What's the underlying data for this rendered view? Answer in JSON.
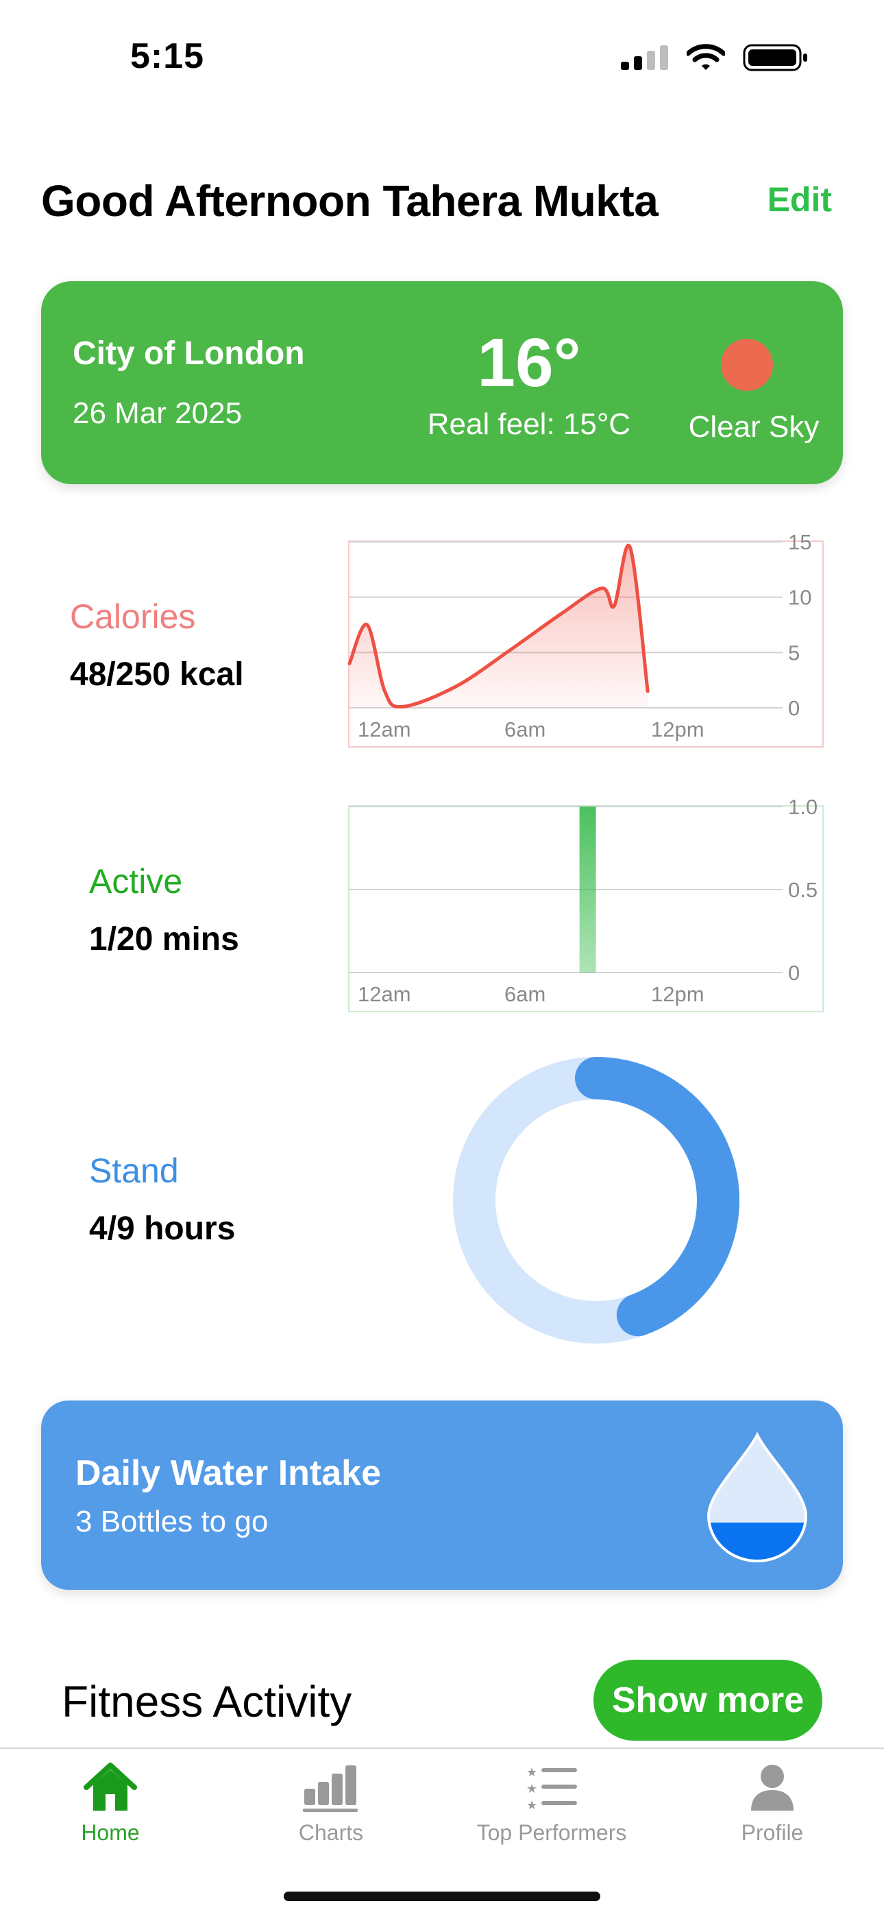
{
  "status_bar": {
    "time": "5:15",
    "icons": [
      "cellular-signal-icon",
      "wifi-icon",
      "battery-icon"
    ]
  },
  "header": {
    "greeting": "Good Afternoon Tahera Mukta",
    "edit_label": "Edit"
  },
  "weather": {
    "city": "City of London",
    "date": "26 Mar 2025",
    "temperature": "16°",
    "real_feel": "Real feel: 15°C",
    "condition": "Clear Sky",
    "condition_icon": "sun-icon",
    "card_color": "#4cb848"
  },
  "calories": {
    "label": "Calories",
    "value": "48/250 kcal",
    "color": "#f07f7f"
  },
  "active": {
    "label": "Active",
    "value": "1/20 mins",
    "color": "#21ad21"
  },
  "stand": {
    "label": "Stand",
    "value": "4/9 hours",
    "color": "#3d8fe3"
  },
  "water": {
    "title": "Daily Water Intake",
    "subtitle": "3 Bottles to go",
    "icon": "water-drop-icon",
    "card_color": "#549be8"
  },
  "fitness": {
    "title": "Fitness Activity",
    "show_more_label": "Show more"
  },
  "tabbar": {
    "tabs": [
      {
        "label": "Home",
        "icon": "home-icon",
        "active": true
      },
      {
        "label": "Charts",
        "icon": "bar-chart-icon",
        "active": false
      },
      {
        "label": "Top Performers",
        "icon": "list-icon",
        "active": false
      },
      {
        "label": "Profile",
        "icon": "person-icon",
        "active": false
      }
    ]
  },
  "chart_data": [
    {
      "type": "area",
      "x_ticks": [
        "12am",
        "6am",
        "12pm"
      ],
      "y_ticks": [
        "0",
        "5",
        "10",
        "15"
      ],
      "ylim": [
        0,
        15
      ],
      "xlim": [
        0,
        24
      ],
      "grid": true,
      "color": "#ee5044",
      "points": [
        [
          0,
          4
        ],
        [
          1,
          7.5
        ],
        [
          2,
          1.5
        ],
        [
          3,
          0.1
        ],
        [
          6,
          1.9
        ],
        [
          9,
          5.1
        ],
        [
          12,
          8.5
        ],
        [
          14.3,
          10.8
        ],
        [
          15,
          9.2
        ],
        [
          15.9,
          14.5
        ],
        [
          16.9,
          1.5
        ]
      ]
    },
    {
      "type": "bar",
      "x_ticks": [
        "12am",
        "6am",
        "12pm"
      ],
      "y_ticks": [
        "0",
        "0.5",
        "1.0"
      ],
      "ylim": [
        0,
        1
      ],
      "xlim": [
        0,
        24
      ],
      "grid": true,
      "color": "#4cc15d",
      "bars": [
        {
          "x": 13.5,
          "value": 1.0
        }
      ]
    },
    {
      "type": "pie",
      "style": "ring",
      "value": 4,
      "total": 9,
      "color": "#4a97ea",
      "track_color": "#d3e6fb"
    }
  ]
}
